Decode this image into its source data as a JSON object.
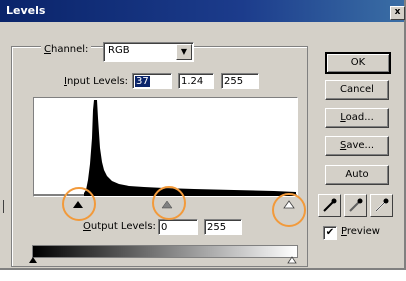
{
  "window": {
    "title": "Levels",
    "close_label": "x"
  },
  "channel": {
    "label_u": "C",
    "label_rest": "hannel:",
    "value": "RGB"
  },
  "input_levels": {
    "label_u": "I",
    "label_rest": "nput Levels:",
    "black": "37",
    "gamma": "1.24",
    "white": "255"
  },
  "output_levels": {
    "label_u": "O",
    "label_rest": "utput Levels:",
    "black": "0",
    "white": "255"
  },
  "buttons": {
    "ok": "OK",
    "cancel": "Cancel",
    "load_u": "L",
    "load_rest": "oad...",
    "save_u": "S",
    "save_rest": "ave...",
    "auto": "Auto"
  },
  "preview": {
    "checked": true,
    "check_mark": "✔",
    "label_u": "P",
    "label_rest": "review"
  },
  "icons": [
    "black-eyedropper-icon",
    "gray-eyedropper-icon",
    "white-eyedropper-icon",
    "close-icon",
    "dropdown-arrow-icon"
  ],
  "colors": {
    "title_bar": "#0a246a",
    "annotation_circle": "#f29a3b",
    "dialog_bg": "#d4d0c8"
  }
}
